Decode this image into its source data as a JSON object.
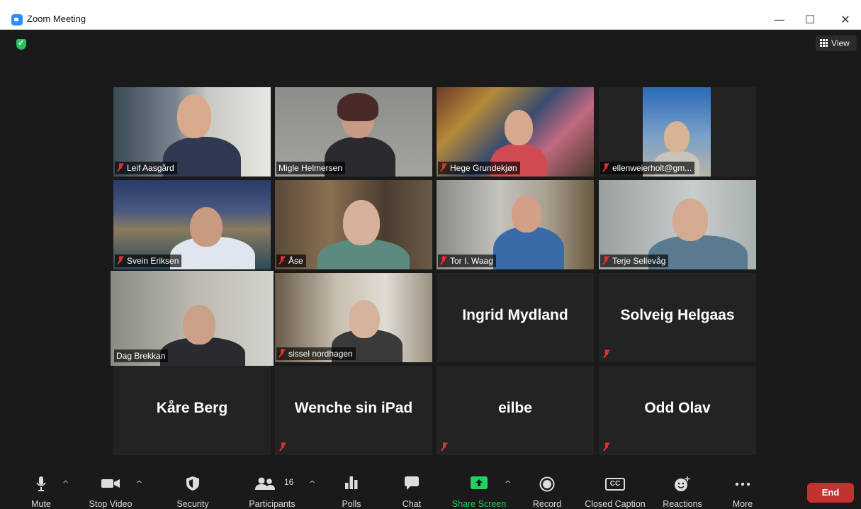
{
  "window": {
    "title": "Zoom Meeting",
    "minimize": "—",
    "maximize": "☐",
    "close": "✕"
  },
  "meeting": {
    "view_label": "View",
    "tiles": [
      {
        "name": "Leif Aasgård",
        "muted": true,
        "video": true
      },
      {
        "name": "Migle Helmersen",
        "muted": false,
        "video": true
      },
      {
        "name": "Hege Grundekjøn",
        "muted": true,
        "video": true
      },
      {
        "name": "ellenweierholt@gm...",
        "muted": true,
        "video": true
      },
      {
        "name": "Svein Eriksen",
        "muted": true,
        "video": true
      },
      {
        "name": "Åse",
        "muted": true,
        "video": true
      },
      {
        "name": "Tor I. Waag",
        "muted": true,
        "video": true
      },
      {
        "name": "Terje Sellevåg",
        "muted": true,
        "video": true
      },
      {
        "name": "Dag Brekkan",
        "muted": false,
        "video": true,
        "active_speaker": true
      },
      {
        "name": "sissel nordhagen",
        "muted": true,
        "video": true
      },
      {
        "name": "Ingrid Mydland",
        "muted": false,
        "video": false
      },
      {
        "name": "Solveig Helgaas",
        "muted": true,
        "video": false
      },
      {
        "name": "Kåre Berg",
        "muted": false,
        "video": false
      },
      {
        "name": "Wenche sin iPad",
        "muted": true,
        "video": false
      },
      {
        "name": "eilbe",
        "muted": true,
        "video": false
      },
      {
        "name": "Odd Olav",
        "muted": true,
        "video": false
      }
    ]
  },
  "toolbar": {
    "mute": "Mute",
    "stop_video": "Stop Video",
    "security": "Security",
    "participants": "Participants",
    "participants_count": "16",
    "polls": "Polls",
    "chat": "Chat",
    "share_screen": "Share Screen",
    "record": "Record",
    "closed_caption": "Closed Caption",
    "cc_badge": "CC",
    "reactions": "Reactions",
    "more": "More",
    "end": "End",
    "caret": "^"
  },
  "colors": {
    "share_green": "#23d160",
    "end_red": "#c53030",
    "muted_red": "#e03131",
    "active_speaker": "#d4e87a"
  }
}
